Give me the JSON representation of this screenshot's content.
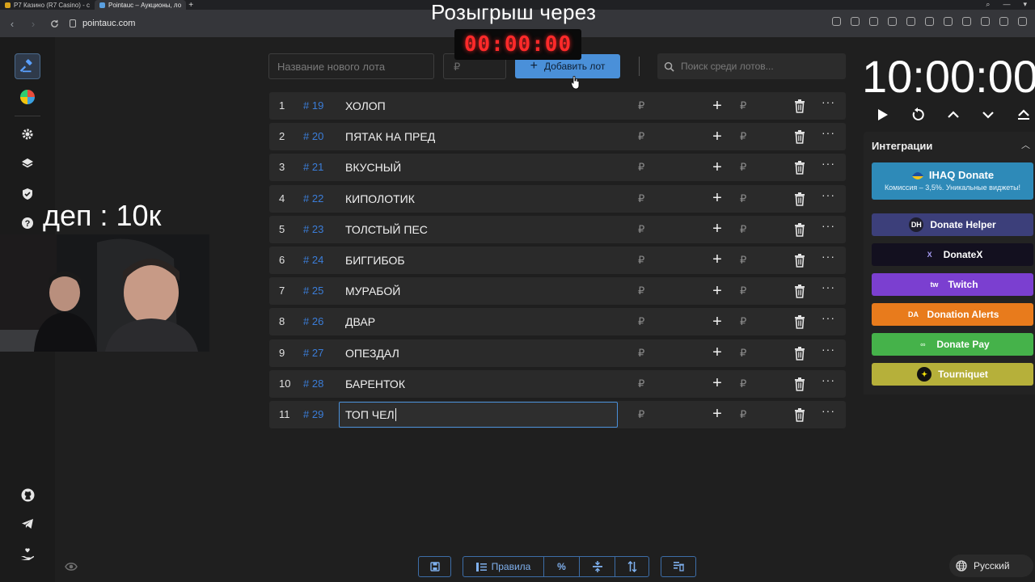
{
  "browser": {
    "tabs": [
      {
        "label": "Р7 Казино (R7 Casino) - с",
        "active": false,
        "favicon_color": "#d7a21b"
      },
      {
        "label": "Pointauc – Аукционы, ло",
        "active": true,
        "favicon_color": "#5aa0e0"
      }
    ],
    "url": "pointauc.com"
  },
  "overlay": {
    "giveaway_title": "Розыгрыш через",
    "giveaway_timer": "00:00:00",
    "deposit_text": "деп : 10к"
  },
  "toolbar": {
    "lot_name_placeholder": "Название нового лота",
    "amount_placeholder": "₽",
    "add_label": "Добавить лот",
    "search_placeholder": "Поиск среди лотов..."
  },
  "lots": [
    {
      "n": "1",
      "id": "# 19",
      "title": "ХОЛОП"
    },
    {
      "n": "2",
      "id": "# 20",
      "title": "ПЯТАК НА ПРЕД"
    },
    {
      "n": "3",
      "id": "# 21",
      "title": "ВКУСНЫЙ"
    },
    {
      "n": "4",
      "id": "# 22",
      "title": "КИПОЛОТИК"
    },
    {
      "n": "5",
      "id": "# 23",
      "title": "ТОЛСТЫЙ ПЕС"
    },
    {
      "n": "6",
      "id": "# 24",
      "title": "БИГГИБОБ"
    },
    {
      "n": "7",
      "id": "# 25",
      "title": "МУРАБОЙ"
    },
    {
      "n": "8",
      "id": "# 26",
      "title": "ДВАР"
    },
    {
      "n": "9",
      "id": "# 27",
      "title": "ОПЕЗДАЛ"
    },
    {
      "n": "10",
      "id": "# 28",
      "title": "БАРЕНТОК"
    },
    {
      "n": "11",
      "id": "# 29",
      "title": "ТОП ЧЕЛ",
      "editing": true
    }
  ],
  "currency_symbol": "₽",
  "timer": {
    "value": "10:00:00"
  },
  "integrations": {
    "header": "Интеграции",
    "ihaq": {
      "title": "IHAQ Donate",
      "subtitle": "Комиссия – 3,5%. Уникальные виджеты!"
    },
    "services": [
      {
        "label": "Donate Helper",
        "color": "#3c3f7a",
        "icon": "DH"
      },
      {
        "label": "DonateX",
        "color": "#13101f",
        "icon": "X"
      },
      {
        "label": "Twitch",
        "color": "#7b3fd0",
        "icon": "tw"
      },
      {
        "label": "Donation Alerts",
        "color": "#e87b1c",
        "icon": "DA"
      },
      {
        "label": "Donate Pay",
        "color": "#45b24a",
        "icon": "∞"
      },
      {
        "label": "Tourniquet",
        "color": "#b6b03a",
        "icon": "✦"
      }
    ]
  },
  "bottom_bar": {
    "rules_label": "Правила",
    "percent_label": "%"
  },
  "language": {
    "label": "Русский"
  }
}
